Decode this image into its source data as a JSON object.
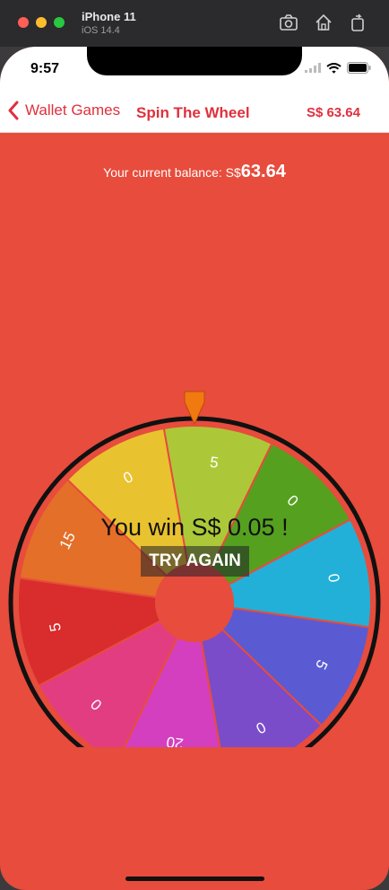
{
  "simulator": {
    "device_name": "iPhone 11",
    "os_version": "iOS 14.4",
    "buttons": [
      "screenshot-icon",
      "home-icon",
      "rotate-icon"
    ]
  },
  "status_bar": {
    "time": "9:57"
  },
  "nav": {
    "back_label": "Wallet Games",
    "title": "Spin The Wheel",
    "balance": "S$ 63.64"
  },
  "balance": {
    "prefix": "Your current balance: S$",
    "amount": "63.64"
  },
  "wheel": {
    "segments": [
      {
        "label": "5",
        "color": "#acc838"
      },
      {
        "label": "0",
        "color": "#55a11f"
      },
      {
        "label": "0",
        "color": "#22b0d8"
      },
      {
        "label": "5",
        "color": "#5a5bd3"
      },
      {
        "label": "0",
        "color": "#7b4cc9"
      },
      {
        "label": "20",
        "color": "#d43fc0"
      },
      {
        "label": "0",
        "color": "#e33d82"
      },
      {
        "label": "5",
        "color": "#d92c2c"
      },
      {
        "label": "15",
        "color": "#e36f28"
      },
      {
        "label": "0",
        "color": "#e9c22f"
      }
    ],
    "pointer_color": "#f07a10"
  },
  "result": {
    "message": "You win S$ 0.05 !",
    "button_label": "TRY AGAIN"
  }
}
